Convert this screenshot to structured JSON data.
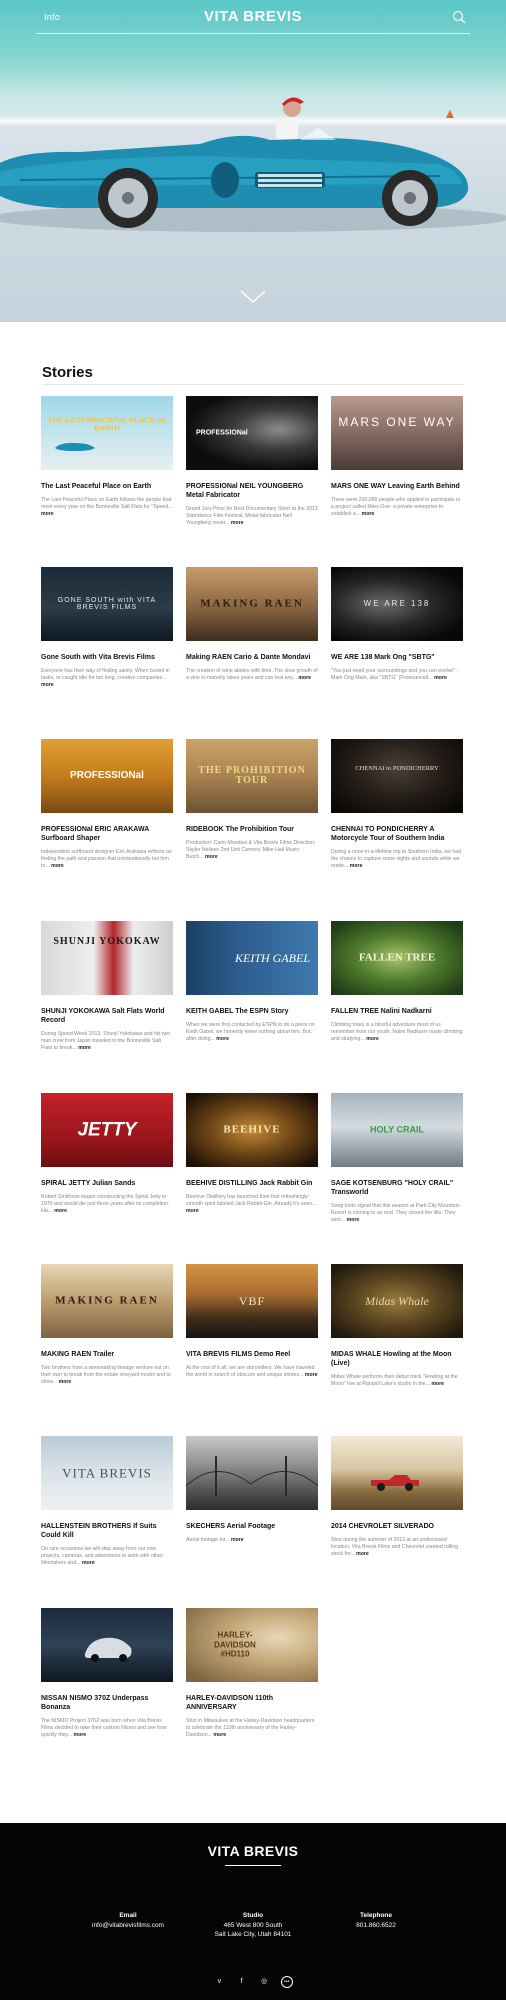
{
  "header": {
    "info_label": "Info",
    "brand": "VITA BREVIS"
  },
  "stories_title": "Stories",
  "more_label": "more",
  "cards": [
    {
      "title": "The Last Peaceful Place on Earth",
      "desc": "The Last Peaceful Place on Earth follows the people that meet every year on the Bonneville Salt Flats for \"Speed...",
      "thumb_text": "THE LAST PEACEFUL PLACE on EARTH"
    },
    {
      "title": "PROFESSIONal NEIL YOUNGBERG Metal Fabricator",
      "desc": "Grand Jury Prize for Best Documentary Short at the 2013 Slamdance Film Festival. Metal-fabricator Neil Youngberg never...",
      "thumb_text": "PROFESSIONal"
    },
    {
      "title": "MARS ONE WAY Leaving Earth Behind",
      "desc": "There were 200,000 people who applied to participate in a project called Mars One: a private enterprise to establish a...",
      "thumb_text": "MARS ONE WAY"
    },
    {
      "title": "Gone South with Vita Brevis Films",
      "desc": "Everyone has their way of finding sanity. When buried in tasks, or caught idle for too long, creative companies...",
      "thumb_text": "GONE SOUTH with VITA BREVIS FILMS"
    },
    {
      "title": "Making RAEN Cario & Dante Mondavi",
      "desc": "The creation of wine abides with time. The slow growth of a vine to maturity takes years and can test any...",
      "thumb_text": "MAKING RAEN"
    },
    {
      "title": "WE ARE 138 Mark Ong \"SBTG\"",
      "desc": "\"You just need your surroundings and you can evolve\" - Mark Ong Mark, aka \"SBTG\" (Pronounced...",
      "thumb_text": "WE ARE 138"
    },
    {
      "title": "PROFESSIONal ERIC ARAKAWA Surfboard Shaper",
      "desc": "Independent surfboard designer Eric Arakawa reflects on finding the path and passion that unintentionally led him to...",
      "thumb_text": "PROFESSIONal"
    },
    {
      "title": "RIDEBOOK The Prohibition Tour",
      "desc": "Production: Carlo Mondavi & Vita Brevis Films Direction: Skyler Neilsen 2nd Unit Camera: Mike Hall Music: Butch...",
      "thumb_text": "THE PROHIBITION TOUR"
    },
    {
      "title": "CHENNAI TO PONDICHERRY A Motorcycle Tour of Southern India",
      "desc": "During a once-in-a-lifetime trip to Southern India, we had the chance to capture some sights and sounds while we made...",
      "thumb_text": "CHENNAI to PONDICHERRY"
    },
    {
      "title": "SHUNJI YOKOKAWA Salt Flats World Record",
      "desc": "During Speed Week 2013, Shunji Yokokawa and his two man crew from Japan traveled to the Bonneville Salt Flats to break...",
      "thumb_text": "SHUNJI YOKOKAW"
    },
    {
      "title": "KEITH GABEL The ESPN Story",
      "desc": "When we were first contacted by ESPN to do a piece on Keith Gabel, we honestly knew nothing about him. But, after doing...",
      "thumb_text": "KEITH GABEL"
    },
    {
      "title": "FALLEN TREE Nalini Nadkarni",
      "desc": "Climbing trees is a blissful adventure most of us remember from our youth. Nalini Nadkarni made climbing and studying...",
      "thumb_text": "FALLEN TREE"
    },
    {
      "title": "SPIRAL JETTY Julian Sands",
      "desc": "Robert Smithson began constructing the Spiral Jetty in 1970 and would die just three years after its completion. His...",
      "thumb_text": "JETTY"
    },
    {
      "title": "BEEHIVE DISTILLING Jack Rabbit Gin",
      "desc": "Beehive Distillery has launched their first refreshingly-smooth spirit labeled Jack Rabbit Gin. Already it's seen...",
      "thumb_text": "BEEHIVE"
    },
    {
      "title": "SAGE KOTSENBURG \"HOLY CRAIL\" Transworld",
      "desc": "Song birds signal that this season at Park City Mountain Resort is coming to an end. They closed the lifts. They sent...",
      "thumb_text": "HOLY CRAIL"
    },
    {
      "title": "MAKING RAEN Trailer",
      "desc": "Two brothers from a winemaking lineage venture out on their own to break from the estate vineyard model and to show...",
      "thumb_text": "MAKING RAEN"
    },
    {
      "title": "VITA BREVIS FILMS Demo Reel",
      "desc": "At the root of it all, we are storytellers. We have traveled the world in search of obscure and unique stories...",
      "thumb_text": "VBF"
    },
    {
      "title": "MIDAS WHALE Howling at the Moon (Live)",
      "desc": "Midas Whale performs their debut track \"Howling at the Moon\" live at Randall Lake's studio in the...",
      "thumb_text": "Midas Whale"
    },
    {
      "title": "HALLENSTEIN BROTHERS If Suits Could Kill",
      "desc": "On rare occasions we will step away from our own projects, cameras, and adventures to work with other filmmakers and...",
      "thumb_text": "VITA BREVIS"
    },
    {
      "title": "SKECHERS Aerial Footage",
      "desc": "Aerial footage for...",
      "thumb_text": ""
    },
    {
      "title": "2014 CHEVROLET SILVERADO",
      "desc": "Shot during the summer of 2013 at an undisclosed location, Vita Brevis Films and Chevrolet created rolling stock for...",
      "thumb_text": ""
    },
    {
      "title": "NISSAN NISMO 370Z Underpass Bonanza",
      "desc": "The NISMO Project 370Z was born when Vita Brevis Films decided to take their custom Nismo and see how quickly they...",
      "thumb_text": ""
    },
    {
      "title": "HARLEY-DAVIDSON 110th ANNIVERSARY",
      "desc": "Shot in Milwaukee at the Harley-Davidson headquarters to celebrate the 110th anniversary of the Harley-Davidson...",
      "thumb_text": "HARLEY-DAVIDSON #HD110"
    }
  ],
  "footer": {
    "brand": "VITA BREVIS",
    "email_label": "Email",
    "email": "info@vitabrevisfilms.com",
    "studio_label": "Studio",
    "studio_line1": "465 West 800 South",
    "studio_line2": "Salt Lake City, Utah 84101",
    "phone_label": "Telephone",
    "phone": "801.860.6522"
  }
}
